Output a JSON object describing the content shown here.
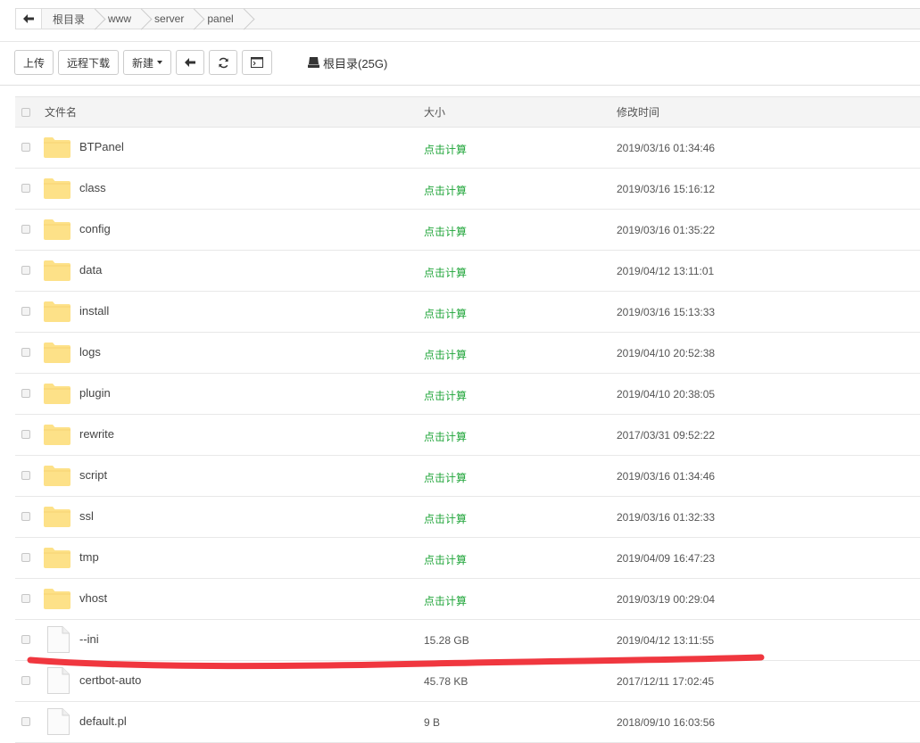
{
  "breadcrumb": {
    "items": [
      "根目录",
      "www",
      "server",
      "panel"
    ]
  },
  "toolbar": {
    "upload": "上传",
    "remote_download": "远程下载",
    "new": "新建",
    "disk_label": "根目录(25G)"
  },
  "table": {
    "headers": {
      "name": "文件名",
      "size": "大小",
      "time": "修改时间"
    },
    "rows": [
      {
        "name": "BTPanel",
        "type": "folder",
        "size": "点击计算",
        "time": "2019/03/16 01:34:46"
      },
      {
        "name": "class",
        "type": "folder",
        "size": "点击计算",
        "time": "2019/03/16 15:16:12"
      },
      {
        "name": "config",
        "type": "folder",
        "size": "点击计算",
        "time": "2019/03/16 01:35:22"
      },
      {
        "name": "data",
        "type": "folder",
        "size": "点击计算",
        "time": "2019/04/12 13:11:01"
      },
      {
        "name": "install",
        "type": "folder",
        "size": "点击计算",
        "time": "2019/03/16 15:13:33"
      },
      {
        "name": "logs",
        "type": "folder",
        "size": "点击计算",
        "time": "2019/04/10 20:52:38"
      },
      {
        "name": "plugin",
        "type": "folder",
        "size": "点击计算",
        "time": "2019/04/10 20:38:05"
      },
      {
        "name": "rewrite",
        "type": "folder",
        "size": "点击计算",
        "time": "2017/03/31 09:52:22"
      },
      {
        "name": "script",
        "type": "folder",
        "size": "点击计算",
        "time": "2019/03/16 01:34:46"
      },
      {
        "name": "ssl",
        "type": "folder",
        "size": "点击计算",
        "time": "2019/03/16 01:32:33"
      },
      {
        "name": "tmp",
        "type": "folder",
        "size": "点击计算",
        "time": "2019/04/09 16:47:23"
      },
      {
        "name": "vhost",
        "type": "folder",
        "size": "点击计算",
        "time": "2019/03/19 00:29:04"
      },
      {
        "name": "--ini",
        "type": "file",
        "size": "15.28 GB",
        "time": "2019/04/12 13:11:55"
      },
      {
        "name": "certbot-auto",
        "type": "file",
        "size": "45.78 KB",
        "time": "2017/12/11 17:02:45"
      },
      {
        "name": "default.pl",
        "type": "file",
        "size": "9 B",
        "time": "2018/09/10 16:03:56"
      }
    ]
  },
  "colors": {
    "calc_green": "#20a53a",
    "folder_yellow": "#fde188",
    "annotation_red": "#f0373f"
  },
  "icons": {
    "folder": "folder-icon",
    "file": "file-icon",
    "back": "arrow-left-icon",
    "refresh": "refresh-icon",
    "terminal": "terminal-icon",
    "disk": "hard-drive-icon"
  }
}
